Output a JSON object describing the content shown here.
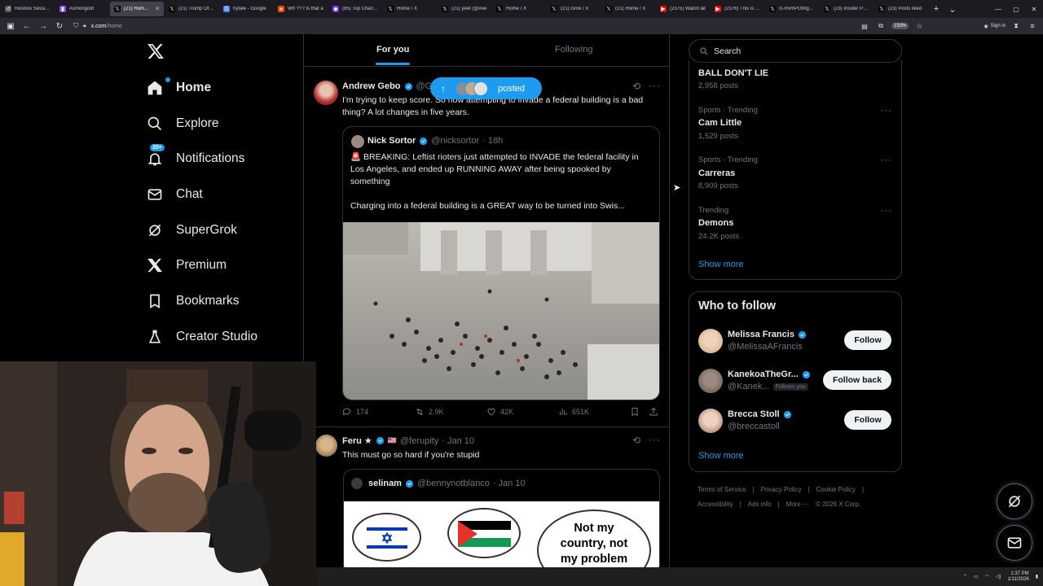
{
  "browser": {
    "tabs": [
      {
        "label": "Restore Session",
        "icon": "restore-icon",
        "color": "#555"
      },
      {
        "label": "Asmongold",
        "icon": "twitch-icon",
        "color": "#9146ff"
      },
      {
        "label": "(21) Home / X",
        "icon": "x-icon",
        "color": "#000",
        "active": true
      },
      {
        "label": "(21) Trump Offer",
        "icon": "x-icon",
        "color": "#000"
      },
      {
        "label": "hytale - Google",
        "icon": "google-icon",
        "color": "#4285f4"
      },
      {
        "label": "Wtf ??? Is that a",
        "icon": "reddit-icon",
        "color": "#ff4500"
      },
      {
        "label": "(85) Top Channe",
        "icon": "app-icon",
        "color": "#7b2ff7"
      },
      {
        "label": "Home / X",
        "icon": "x-icon",
        "color": "#000"
      },
      {
        "label": "(21) yeet (@Awi",
        "icon": "x-icon",
        "color": "#000"
      },
      {
        "label": "Home / X",
        "icon": "x-icon",
        "color": "#000"
      },
      {
        "label": "(21) Grok / X",
        "icon": "x-icon",
        "color": "#000"
      },
      {
        "label": "(21) Home / X",
        "icon": "x-icon",
        "color": "#000"
      },
      {
        "label": "(2375) Watch lat",
        "icon": "youtube-icon",
        "color": "#ff0000"
      },
      {
        "label": "(2376) This is Hy",
        "icon": "youtube-icon",
        "color": "#ff0000"
      },
      {
        "label": "G-RvmPOWgAA",
        "icon": "x-icon",
        "color": "#000"
      },
      {
        "label": "(23) Insider Pape",
        "icon": "x-icon",
        "color": "#000"
      },
      {
        "label": "(23) Posts liked",
        "icon": "x-icon",
        "color": "#000"
      }
    ],
    "url_host": "x.com",
    "url_path": "/home",
    "zoom": "150%",
    "signin_label": "Sign in"
  },
  "nav": {
    "items": [
      {
        "label": "Home",
        "icon": "home-icon",
        "key": "home"
      },
      {
        "label": "Explore",
        "icon": "search-icon",
        "key": "explore"
      },
      {
        "label": "Notifications",
        "icon": "bell-icon",
        "key": "notifications",
        "badge": "20+"
      },
      {
        "label": "Chat",
        "icon": "mail-icon",
        "key": "chat"
      },
      {
        "label": "SuperGrok",
        "icon": "grok-icon",
        "key": "supergrok"
      },
      {
        "label": "Premium",
        "icon": "x-icon",
        "key": "premium"
      },
      {
        "label": "Bookmarks",
        "icon": "bookmark-icon",
        "key": "bookmarks"
      },
      {
        "label": "Creator Studio",
        "icon": "flask-icon",
        "key": "creator-studio"
      }
    ]
  },
  "feed": {
    "tabs": {
      "for_you": "For you",
      "following": "Following"
    },
    "posted_pill": "posted",
    "tweet1": {
      "name": "Andrew Gebo",
      "handle": "@G",
      "text": "I'm trying to keep score. So now attempting to invade a federal building is a bad thing? A lot changes in five years.",
      "quote": {
        "name": "Nick Sortor",
        "handle": "@nicksortor",
        "time": "· 18h",
        "text1": "🚨 BREAKING: Leftist rioters just attempted to INVADE the federal facility in Los Angeles, and ended up RUNNING AWAY after being spooked by something",
        "text2": "Charging into a federal building is a GREAT way to be turned into Swis..."
      },
      "stats": {
        "replies": "174",
        "reposts": "2.9K",
        "likes": "42K",
        "views": "651K"
      }
    },
    "tweet2": {
      "name": "Feru ★",
      "flag": "🇺🇸",
      "handle": "@ferupity",
      "time": "· Jan 10",
      "text": "This must go so hard if you're stupid",
      "quote": {
        "name": "selinam",
        "handle": "@bennynotblanco",
        "time": "· Jan 10",
        "bubble_text": "Not my country, not my problem"
      }
    }
  },
  "right": {
    "search_placeholder": "Search",
    "trends": [
      {
        "sub": "",
        "name": "BALL DON'T LIE",
        "posts": "2,958 posts"
      },
      {
        "sub": "Sports · Trending",
        "name": "Cam Little",
        "posts": "1,529 posts"
      },
      {
        "sub": "Sports · Trending",
        "name": "Carreras",
        "posts": "8,909 posts"
      },
      {
        "sub": "Trending",
        "name": "Demons",
        "posts": "24.2K posts"
      }
    ],
    "trends_show_more": "Show more",
    "who_to_follow_title": "Who to follow",
    "follow": [
      {
        "name": "Melissa Francis",
        "handle": "@MelissaAFrancis",
        "button": "Follow"
      },
      {
        "name": "KanekoaTheGr...",
        "handle": "@Kanek...",
        "follows_you": "Follows you",
        "button": "Follow back"
      },
      {
        "name": "Brecca Stoll",
        "handle": "@breccastoll",
        "button": "Follow"
      }
    ],
    "follow_show_more": "Show more",
    "footer_row1": [
      "Terms of Service",
      "|",
      "Privacy Policy",
      "|",
      "Cookie Policy",
      "|"
    ],
    "footer_row2": [
      "Accessibility",
      "|",
      "Ads info",
      "|",
      "More ···",
      "© 2026 X Corp."
    ]
  },
  "taskbar": {
    "time": "1:37 PM",
    "date": "1/11/2026"
  },
  "colors": {
    "accent": "#1d9bf0",
    "bg": "#000000",
    "border": "#2f3336",
    "muted": "#71767b"
  }
}
